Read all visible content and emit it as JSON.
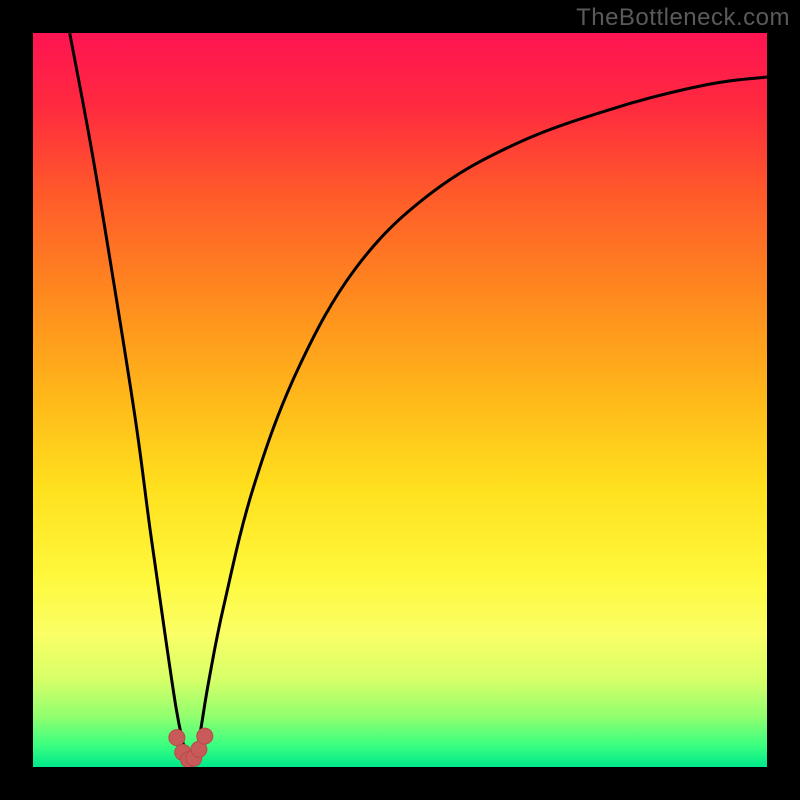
{
  "watermark": "TheBottleneck.com",
  "colors": {
    "page_bg": "#000000",
    "curve": "#000000",
    "marker_fill": "#c95a5a",
    "marker_stroke": "#b84a4a",
    "gradient_stops": [
      {
        "offset": 0.0,
        "color": "#ff1452"
      },
      {
        "offset": 0.1,
        "color": "#ff2a3f"
      },
      {
        "offset": 0.22,
        "color": "#ff5a2a"
      },
      {
        "offset": 0.36,
        "color": "#ff8a1e"
      },
      {
        "offset": 0.5,
        "color": "#ffb91a"
      },
      {
        "offset": 0.62,
        "color": "#ffe01e"
      },
      {
        "offset": 0.74,
        "color": "#fff83c"
      },
      {
        "offset": 0.82,
        "color": "#faff66"
      },
      {
        "offset": 0.88,
        "color": "#d7ff68"
      },
      {
        "offset": 0.93,
        "color": "#93ff6e"
      },
      {
        "offset": 0.97,
        "color": "#3bff80"
      },
      {
        "offset": 1.0,
        "color": "#00e88a"
      }
    ]
  },
  "chart_data": {
    "type": "line",
    "title": "",
    "xlabel": "",
    "ylabel": "",
    "xlim": [
      0,
      100
    ],
    "ylim": [
      0,
      100
    ],
    "grid": false,
    "legend": false,
    "series": [
      {
        "name": "bottleneck-curve",
        "x": [
          5,
          8,
          11,
          14,
          16,
          18,
          19.5,
          20.5,
          21,
          21.5,
          22,
          22.5,
          23,
          24,
          26,
          30,
          36,
          44,
          54,
          66,
          80,
          92,
          100
        ],
        "y": [
          100,
          84,
          66,
          47,
          32,
          18,
          8,
          3,
          1,
          0.5,
          1,
          3,
          6,
          12,
          22,
          38,
          54,
          68,
          78,
          85,
          90,
          93,
          94
        ]
      }
    ],
    "markers": {
      "name": "trough-markers",
      "x": [
        19.6,
        20.4,
        21.2,
        21.9,
        22.6,
        23.4
      ],
      "y": [
        4.0,
        2.0,
        1.0,
        1.2,
        2.4,
        4.2
      ]
    }
  }
}
